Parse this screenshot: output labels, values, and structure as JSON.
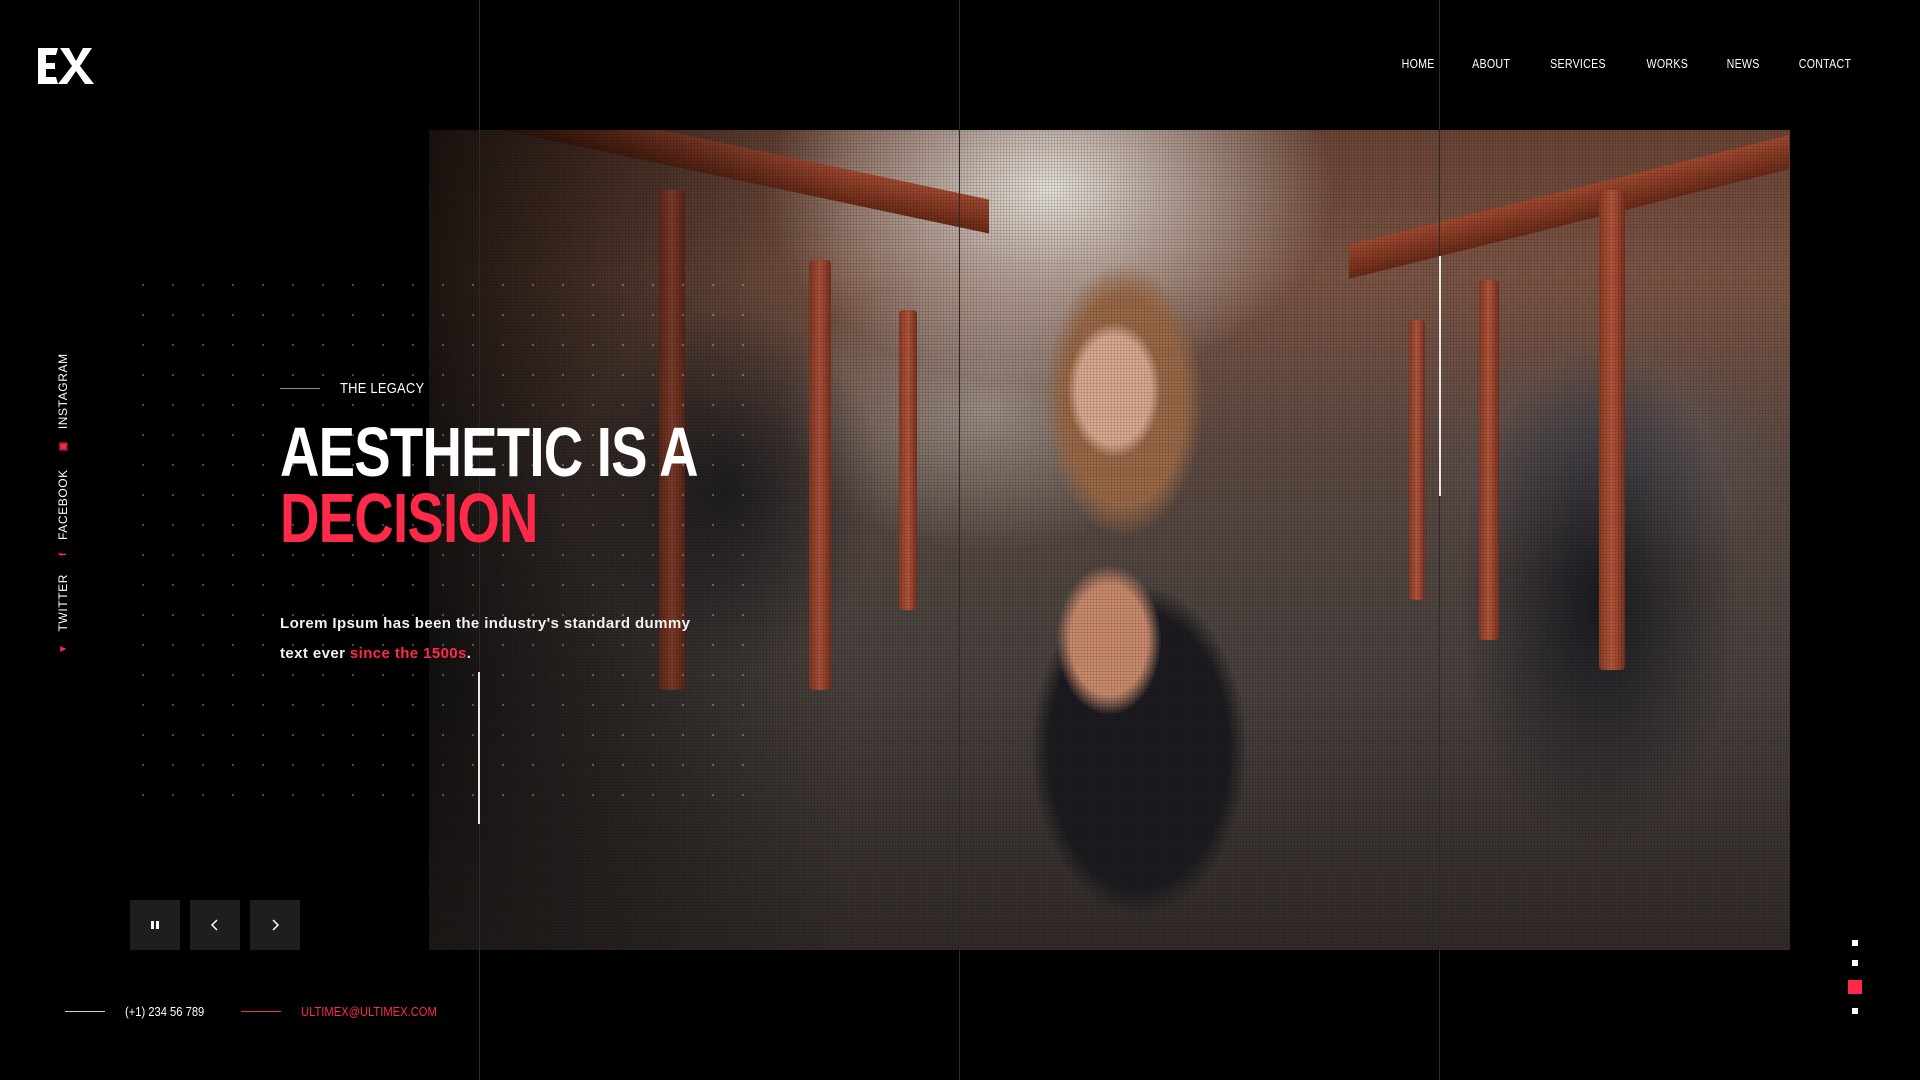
{
  "brand": {
    "logo_text": "EX"
  },
  "nav": {
    "items": [
      "HOME",
      "ABOUT",
      "SERVICES",
      "WORKS",
      "NEWS",
      "CONTACT"
    ]
  },
  "hero": {
    "eyebrow": "THE LEGACY",
    "headline_line1": "AESTHETIC IS A",
    "headline_line2": "DECISION",
    "lead_text": "Lorem Ipsum has been the industry's standard dummy text ever",
    "lead_highlight": "since the 1500s",
    "lead_end": "."
  },
  "social": {
    "instagram": "INSTAGRAM",
    "facebook": "FACEBOOK",
    "twitter": "TWITTER"
  },
  "contact": {
    "phone": "(+1) 234 56 789",
    "email": "ULTIMEX@ULTIMEX.COM"
  },
  "slider": {
    "controls": [
      "pause-icon",
      "chevron-left-icon",
      "chevron-right-icon"
    ],
    "pages": 4,
    "active_page": 3
  },
  "colors": {
    "accent": "#ff2a4a",
    "background": "#000000",
    "control_bg": "#1e1e1e"
  }
}
